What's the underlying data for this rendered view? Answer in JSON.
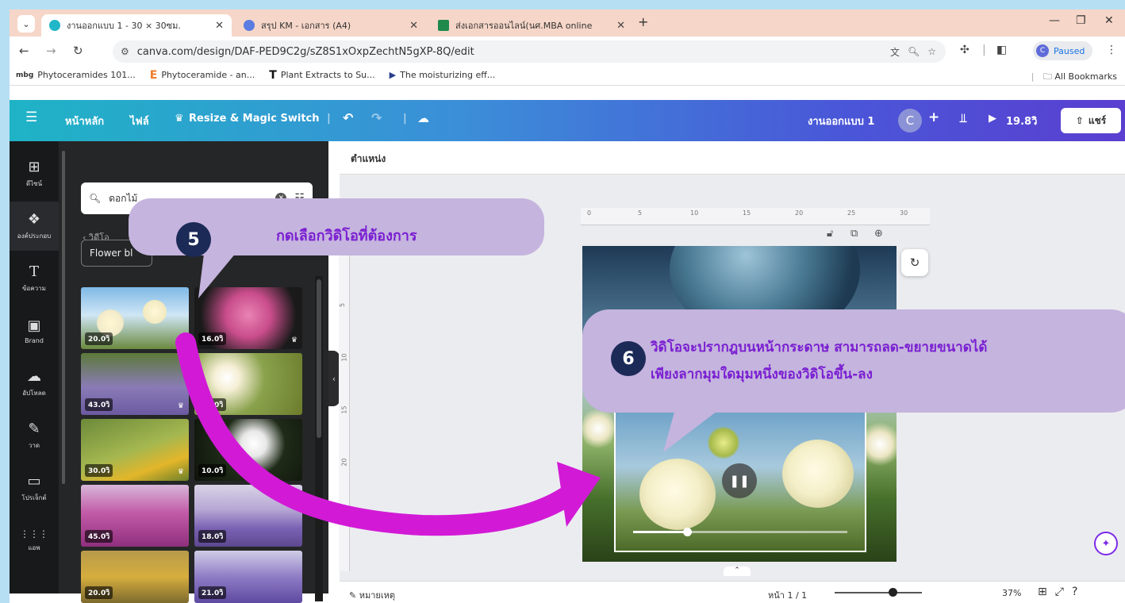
{
  "browser": {
    "tabs": [
      {
        "title": "งานออกแบบ 1 - 30 × 30ซม.",
        "active": true
      },
      {
        "title": "สรุป KM - เอกสาร (A4)",
        "active": false
      },
      {
        "title": "ส่งเอกสารออนไลน์(นศ.MBA online",
        "active": false
      }
    ],
    "new_tab": "+",
    "url": "canva.com/design/DAF-PED9C2g/sZ8S1xOxpZechtN5gXP-8Q/edit",
    "profile_status": "Paused",
    "bookmarks": [
      {
        "icon": "mbg",
        "label": "Phytoceramides 101..."
      },
      {
        "icon": "E",
        "label": "Phytoceramide - an..."
      },
      {
        "icon": "T",
        "label": "Plant Extracts to Su..."
      },
      {
        "icon": "▶",
        "label": "The moisturizing eff..."
      }
    ],
    "all_bookmarks": "All Bookmarks"
  },
  "canva_bar": {
    "home": "หน้าหลัก",
    "file": "ไฟล์",
    "resize": "Resize & Magic Switch",
    "design_name": "งานออกแบบ 1",
    "avatar": "C",
    "duration": "19.8วิ",
    "share": "แชร์"
  },
  "rail": [
    {
      "icon": "⊞",
      "label": "ดีไซน์"
    },
    {
      "icon": "❖",
      "label": "องค์ประกอบ"
    },
    {
      "icon": "T",
      "label": "ข้อความ"
    },
    {
      "icon": "▣",
      "label": "Brand"
    },
    {
      "icon": "☁",
      "label": "อัปโหลด"
    },
    {
      "icon": "✎",
      "label": "วาด"
    },
    {
      "icon": "▭",
      "label": "โปรเจ็กต์"
    },
    {
      "icon": "⋮⋮⋮",
      "label": "แอพ"
    }
  ],
  "panel": {
    "search_value": "ดอกไม้",
    "back_label": "วิดีโอ",
    "chip": "Flower bl",
    "videos": [
      {
        "duration": "20.0วิ",
        "premium": true
      },
      {
        "duration": "16.0วิ",
        "premium": true
      },
      {
        "duration": "43.0วิ",
        "premium": true
      },
      {
        "duration": "20.0วิ",
        "premium": false
      },
      {
        "duration": "30.0วิ",
        "premium": true
      },
      {
        "duration": "10.0วิ",
        "premium": false
      },
      {
        "duration": "45.0วิ",
        "premium": false
      },
      {
        "duration": "18.0วิ",
        "premium": false
      },
      {
        "duration": "20.0วิ",
        "premium": false
      },
      {
        "duration": "21.0วิ",
        "premium": false
      }
    ]
  },
  "editor": {
    "position_label": "ตำแหน่ง",
    "ruler_h": [
      "0",
      "5",
      "10",
      "15",
      "20",
      "25",
      "30"
    ],
    "ruler_v": [
      "5",
      "10",
      "15",
      "20",
      "25"
    ],
    "notes": "หมายเหตุ",
    "page_indicator": "หน้า 1 / 1",
    "zoom": "37%",
    "video_progress": 0.25
  },
  "callouts": {
    "step5": {
      "num": "5",
      "text": "กดเลือกวิดิโอที่ต้องการ"
    },
    "step6": {
      "num": "6",
      "line1": "วิดิโอจะปรากฎบนหน้ากระดาษ สามารถลด-ขยายขนาดได้",
      "line2": "เพียงลากมุมใดมุมหนึ่งของวิดิโอขึ้น-ลง"
    }
  },
  "colors": {
    "callout_bg": "#c5b4de",
    "callout_text": "#7a1fd1",
    "arrow": "#d21ad6",
    "badge": "#1c2a57"
  }
}
